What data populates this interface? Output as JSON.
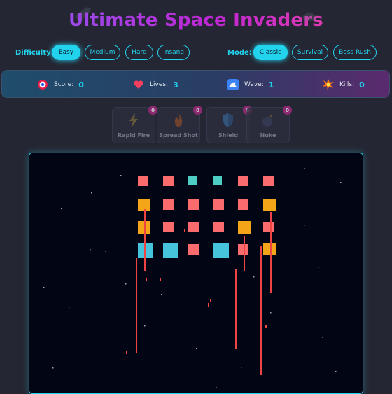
{
  "title": "Ultimate Space Invaders",
  "difficulty": {
    "label": "Difficulty:",
    "options": [
      "Easy",
      "Medium",
      "Hard",
      "Insane"
    ],
    "selected": "Easy"
  },
  "mode": {
    "label": "Mode:",
    "options": [
      "Classic",
      "Survival",
      "Boss Rush"
    ],
    "selected": "Classic"
  },
  "stats": {
    "score": {
      "label": "Score:",
      "value": "0",
      "icon": "target-icon"
    },
    "lives": {
      "label": "Lives:",
      "value": "3",
      "icon": "heart-icon"
    },
    "wave": {
      "label": "Wave:",
      "value": "1",
      "icon": "wave-icon"
    },
    "kills": {
      "label": "Kills:",
      "value": "0",
      "icon": "explosion-icon"
    }
  },
  "powerups": [
    {
      "name": "Rapid Fire",
      "count": "0",
      "icon": "lightning-icon"
    },
    {
      "name": "Spread Shot",
      "count": "0",
      "icon": "flame-icon"
    },
    {
      "name": "Shield",
      "count": "0",
      "icon": "shield-icon"
    },
    {
      "name": "Nuke",
      "count": "0",
      "icon": "bomb-icon"
    }
  ],
  "colors": {
    "accent": "#22d3ee",
    "enemy_red": "#fa6b6e",
    "enemy_orange": "#f5a518",
    "enemy_cyan": "#45c4dc",
    "enemy_teal": "#4ecdc4",
    "bullet": "#ef4444"
  }
}
